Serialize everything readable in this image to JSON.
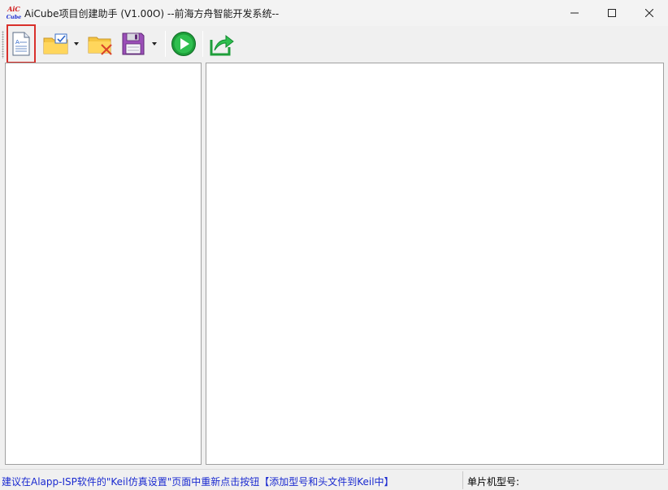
{
  "window": {
    "title": "AiCube项目创建助手 (V1.00O) --前海方舟智能开发系统--",
    "logo_text_top": "AiC",
    "logo_text_bottom": "Cube",
    "controls": {
      "minimize_icon": "minimize-icon",
      "maximize_icon": "maximize-icon",
      "close_icon": "close-icon"
    }
  },
  "toolbar": {
    "buttons": [
      {
        "id": "new-project",
        "icon": "new-document-icon",
        "highlighted": true
      },
      {
        "id": "open-project",
        "icon": "folder-open-check-icon",
        "has_dropdown": true
      },
      {
        "id": "close-project",
        "icon": "folder-delete-icon"
      },
      {
        "id": "save-project",
        "icon": "floppy-disk-icon",
        "has_dropdown": true
      },
      {
        "id": "run",
        "icon": "play-icon"
      },
      {
        "id": "export",
        "icon": "share-export-icon"
      }
    ],
    "highlight_color": "#d9302b"
  },
  "statusbar": {
    "hint": "建议在Alapp-ISP软件的\"Keil仿真设置\"页面中重新点击按钮【添加型号和头文件到Keil中】",
    "mcu_label": "单片机型号:",
    "hint_color": "#1a2ad0"
  }
}
